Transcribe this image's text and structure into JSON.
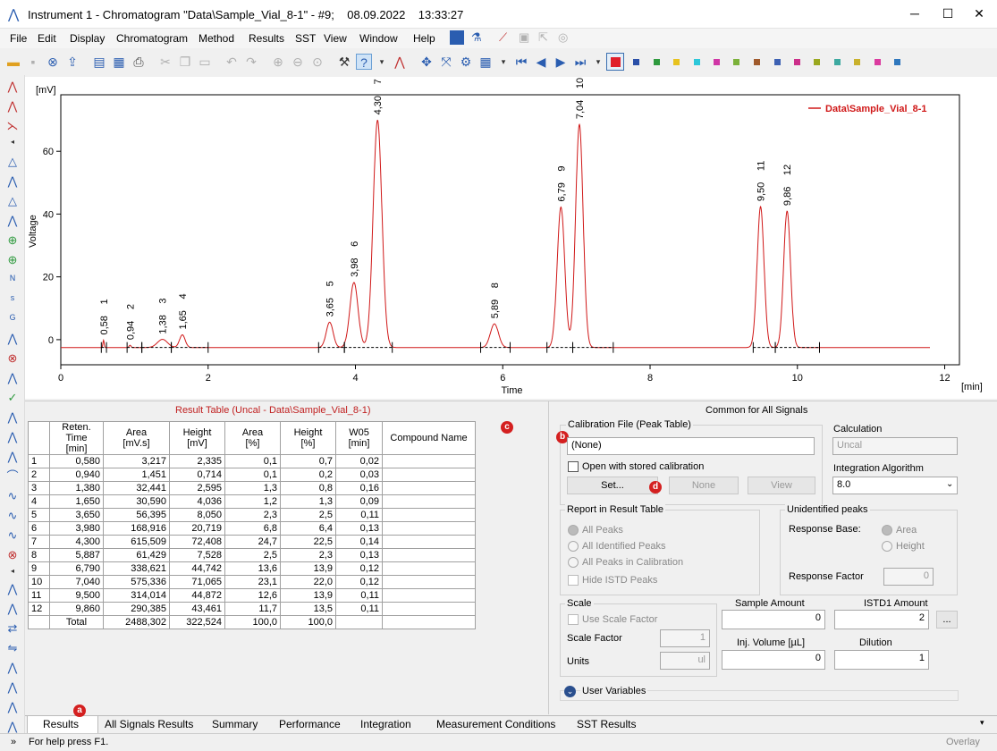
{
  "window": {
    "title": "Instrument 1 - Chromatogram \"Data\\Sample_Vial_8-1\" - #9;    08.09.2022    13:33:27",
    "min": "─",
    "max": "☐",
    "close": "✕"
  },
  "menu": [
    "File",
    "Edit",
    "Display",
    "Chromatogram",
    "Method",
    "Results",
    "SST",
    "View",
    "Window",
    "Help"
  ],
  "toolbar_colors": [
    "#e01f2b",
    "#2a4fa8",
    "#2e9a3e",
    "#e7c21e",
    "#2cc7d9",
    "#d036a6",
    "#7bb13a",
    "#a05a2c",
    "#3d61b3",
    "#cc2f8a",
    "#9aa81f",
    "#3da9a0",
    "#c9b12c",
    "#db3b9f",
    "#2f77bd"
  ],
  "chart": {
    "y_unit": "[mV]",
    "x_unit": "[min]",
    "ylabel": "Voltage",
    "xlabel": "Time",
    "legend": "Data\\Sample_Vial_8-1",
    "x_ticks": [
      "0",
      "2",
      "4",
      "6",
      "8",
      "10",
      "12"
    ],
    "y_ticks": [
      "0",
      "20",
      "40",
      "60"
    ]
  },
  "chart_data": {
    "type": "line",
    "title": "",
    "xlabel": "Time",
    "ylabel": "Voltage",
    "xlim": [
      0,
      12.2
    ],
    "ylim": [
      -8,
      78
    ],
    "series": [
      {
        "name": "Data\\Sample_Vial_8-1",
        "peaks": [
          [
            0.58,
            2.335,
            0.02
          ],
          [
            0.94,
            0.714,
            0.03
          ],
          [
            1.38,
            2.595,
            0.16
          ],
          [
            1.65,
            4.036,
            0.09
          ],
          [
            3.65,
            8.05,
            0.11
          ],
          [
            3.98,
            20.719,
            0.13
          ],
          [
            4.3,
            72.408,
            0.14
          ],
          [
            5.887,
            7.528,
            0.13
          ],
          [
            6.79,
            44.742,
            0.12
          ],
          [
            7.04,
            71.065,
            0.12
          ],
          [
            9.5,
            44.872,
            0.11
          ],
          [
            9.86,
            43.461,
            0.11
          ]
        ],
        "baseline": -2.5
      }
    ],
    "peak_labels": [
      {
        "n": "1",
        "t": "0,58"
      },
      {
        "n": "2",
        "t": "0,94"
      },
      {
        "n": "3",
        "t": "1,38"
      },
      {
        "n": "4",
        "t": "1,65"
      },
      {
        "n": "5",
        "t": "3,65"
      },
      {
        "n": "6",
        "t": "3,98"
      },
      {
        "n": "7",
        "t": "4,30"
      },
      {
        "n": "8",
        "t": "5,89"
      },
      {
        "n": "9",
        "t": "6,79"
      },
      {
        "n": "10",
        "t": "7,04"
      },
      {
        "n": "11",
        "t": "9,50"
      },
      {
        "n": "12",
        "t": "9,86"
      }
    ]
  },
  "result_table": {
    "title": "Result Table (Uncal - Data\\Sample_Vial_8-1)",
    "headers": [
      "",
      "Reten. Time\n[min]",
      "Area\n[mV.s]",
      "Height\n[mV]",
      "Area\n[%]",
      "Height\n[%]",
      "W05\n[min]",
      "Compound Name"
    ],
    "rows": [
      [
        "1",
        "0,580",
        "3,217",
        "2,335",
        "0,1",
        "0,7",
        "0,02",
        ""
      ],
      [
        "2",
        "0,940",
        "1,451",
        "0,714",
        "0,1",
        "0,2",
        "0,03",
        ""
      ],
      [
        "3",
        "1,380",
        "32,441",
        "2,595",
        "1,3",
        "0,8",
        "0,16",
        ""
      ],
      [
        "4",
        "1,650",
        "30,590",
        "4,036",
        "1,2",
        "1,3",
        "0,09",
        ""
      ],
      [
        "5",
        "3,650",
        "56,395",
        "8,050",
        "2,3",
        "2,5",
        "0,11",
        ""
      ],
      [
        "6",
        "3,980",
        "168,916",
        "20,719",
        "6,8",
        "6,4",
        "0,13",
        ""
      ],
      [
        "7",
        "4,300",
        "615,509",
        "72,408",
        "24,7",
        "22,5",
        "0,14",
        ""
      ],
      [
        "8",
        "5,887",
        "61,429",
        "7,528",
        "2,5",
        "2,3",
        "0,13",
        ""
      ],
      [
        "9",
        "6,790",
        "338,621",
        "44,742",
        "13,6",
        "13,9",
        "0,12",
        ""
      ],
      [
        "10",
        "7,040",
        "575,336",
        "71,065",
        "23,1",
        "22,0",
        "0,12",
        ""
      ],
      [
        "11",
        "9,500",
        "314,014",
        "44,872",
        "12,6",
        "13,9",
        "0,11",
        ""
      ],
      [
        "12",
        "9,860",
        "290,385",
        "43,461",
        "11,7",
        "13,5",
        "0,11",
        ""
      ],
      [
        "",
        "Total",
        "2488,302",
        "322,524",
        "100,0",
        "100,0",
        "",
        ""
      ]
    ]
  },
  "right": {
    "header": "Common for All Signals",
    "calib_label": "Calibration File (Peak Table)",
    "calib_value": "(None)",
    "open_stored": "Open with stored calibration",
    "set_btn": "Set...",
    "none_btn": "None",
    "view_btn": "View",
    "calc_label": "Calculation",
    "calc_value": "Uncal",
    "integ_label": "Integration Algorithm",
    "integ_value": "8.0",
    "report_label": "Report in Result Table",
    "report_opts": [
      "All Peaks",
      "All Identified Peaks",
      "All Peaks in Calibration",
      "Hide ISTD Peaks"
    ],
    "unident_label": "Unidentified peaks",
    "resp_base": "Response Base:",
    "area": "Area",
    "height": "Height",
    "resp_factor": "Response Factor",
    "resp_factor_val": "0",
    "scale": "Scale",
    "use_scale": "Use Scale Factor",
    "scale_factor": "Scale Factor",
    "scale_factor_val": "1",
    "units": "Units",
    "units_val": "ul",
    "sample_amount": "Sample Amount",
    "sample_amount_val": "0",
    "istd": "ISTD1 Amount",
    "istd_val": "2",
    "more_btn": "...",
    "inj": "Inj. Volume [µL]",
    "inj_val": "0",
    "dilution": "Dilution",
    "dilution_val": "1",
    "user_vars": "User Variables"
  },
  "badges": {
    "a": "a",
    "b": "b",
    "c": "c",
    "d": "d"
  },
  "tabs": [
    "Results",
    "All Signals Results",
    "Summary",
    "Performance",
    "Integration",
    "Measurement Conditions",
    "SST Results"
  ],
  "status": {
    "help": "For help press F1.",
    "overlay": "Overlay",
    "arrows": "»"
  }
}
